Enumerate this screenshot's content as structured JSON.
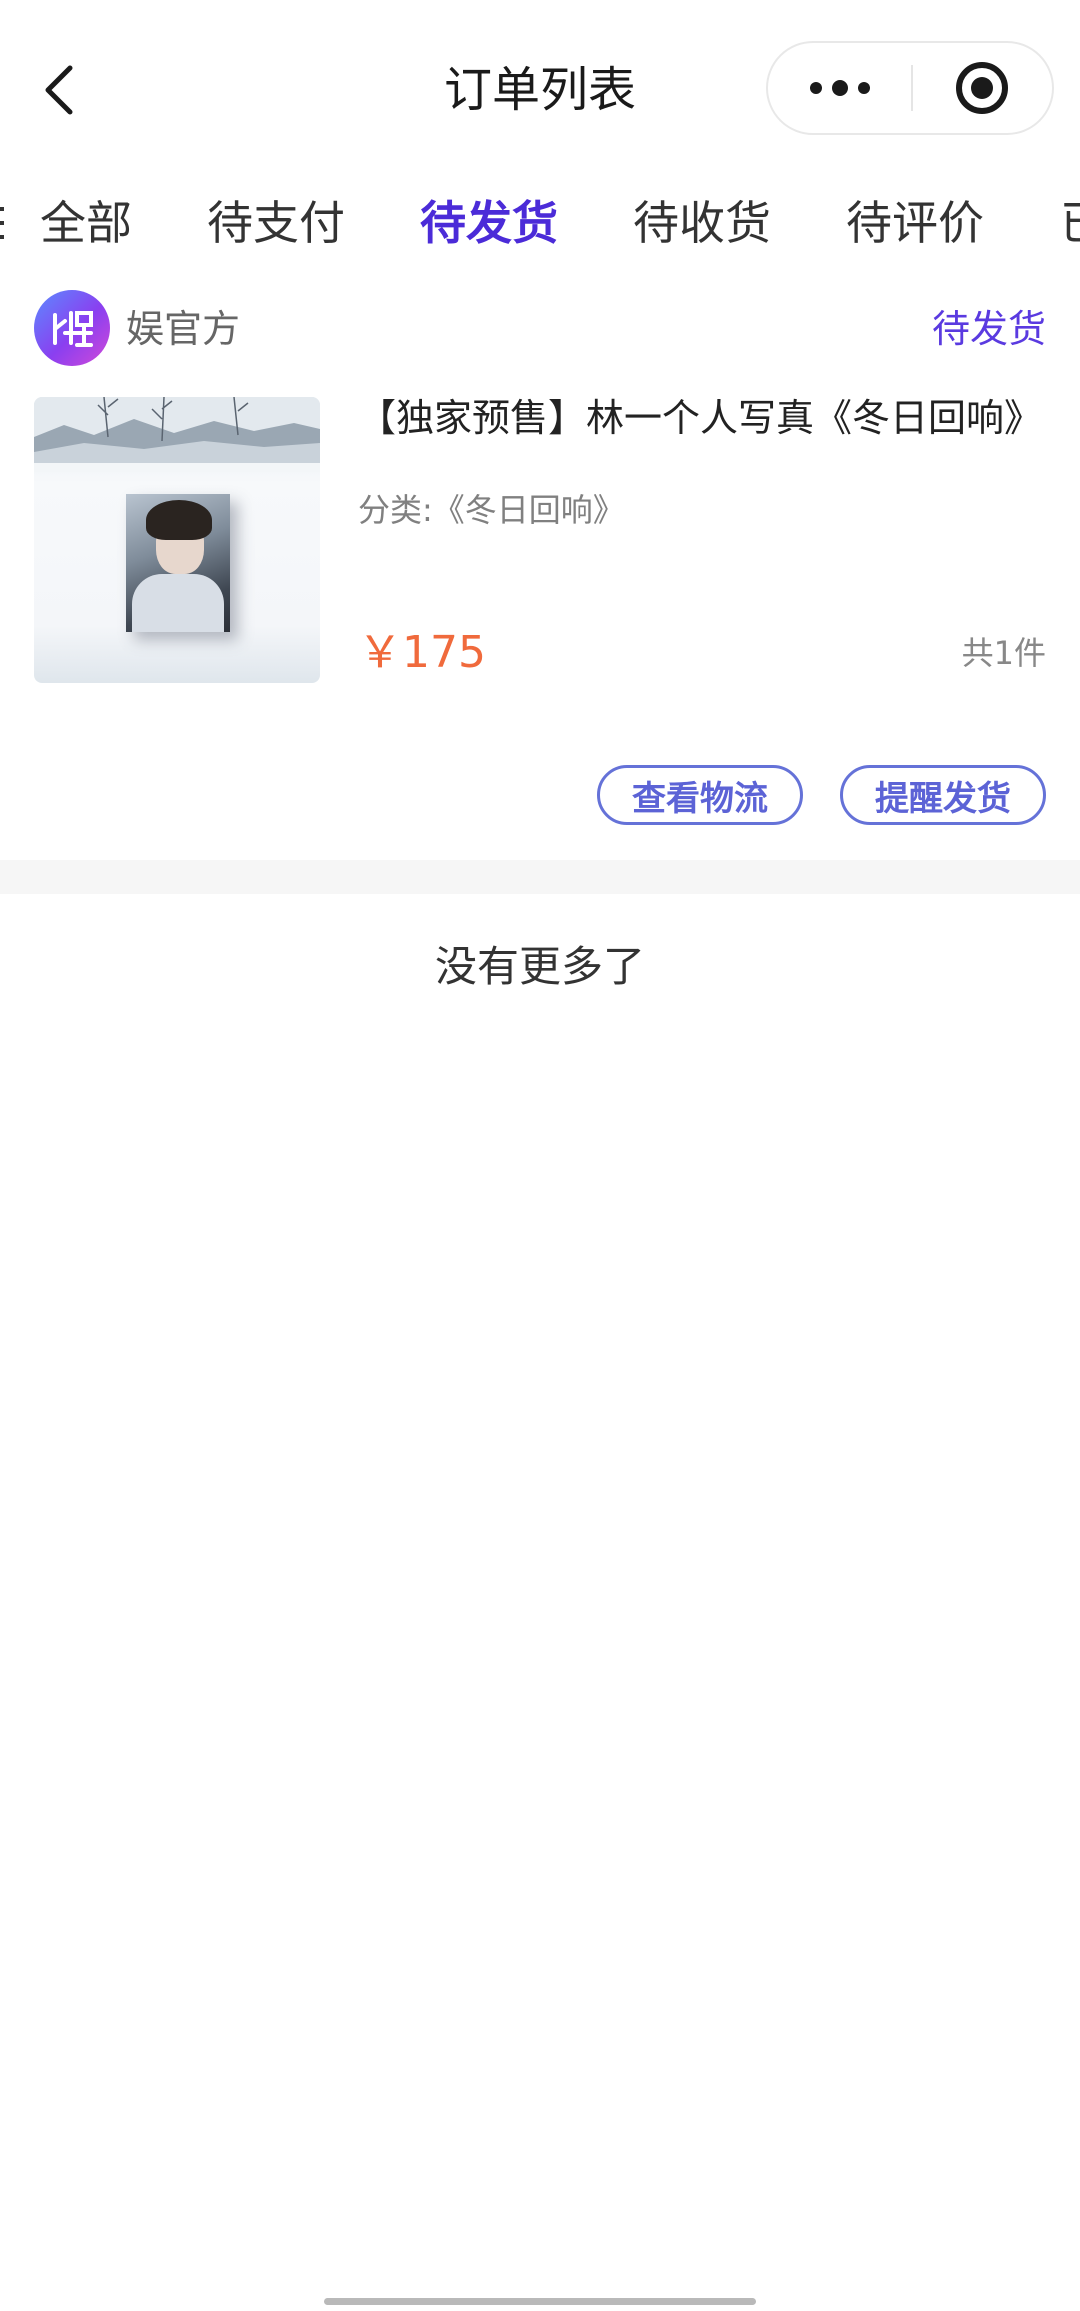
{
  "navbar": {
    "title": "订单列表",
    "back_icon": "chevron-left-icon",
    "more_icon": "more-dots-icon",
    "close_icon": "target-circle-icon"
  },
  "tabs": [
    {
      "label": "全部",
      "active": false
    },
    {
      "label": "待支付",
      "active": false
    },
    {
      "label": "待发货",
      "active": true
    },
    {
      "label": "待收货",
      "active": false
    },
    {
      "label": "待评价",
      "active": false
    },
    {
      "label": "已",
      "active": false
    }
  ],
  "order": {
    "shop_name": "娱官方",
    "status": "待发货",
    "product_title": "【独家预售】林一个人写真《冬日回响》",
    "category": "分类:《冬日回响》",
    "price": "￥175",
    "count": "共1件",
    "buttons": {
      "logistics": "查看物流",
      "remind": "提醒发货"
    }
  },
  "footer": {
    "no_more": "没有更多了"
  },
  "colors": {
    "accent": "#4b2bd8",
    "status": "#5a3ae0",
    "price": "#f06a3c",
    "button_border": "#6572d8"
  }
}
